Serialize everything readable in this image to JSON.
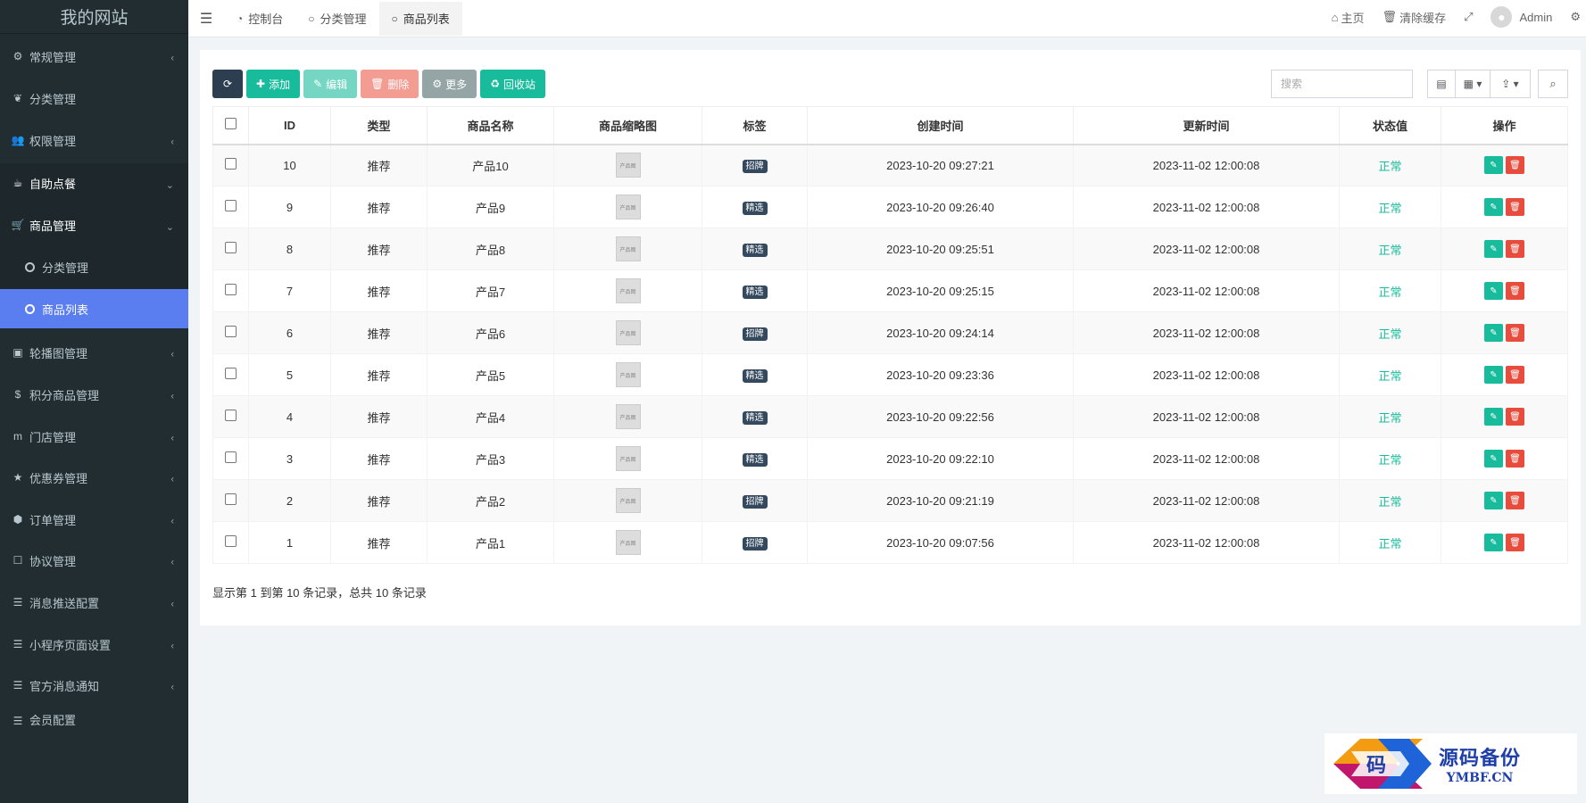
{
  "sidebar": {
    "logo": "我的网站",
    "items": [
      {
        "label": "常规管理",
        "icon": "cogs-icon"
      },
      {
        "label": "分类管理",
        "icon": "leaf-icon"
      },
      {
        "label": "权限管理",
        "icon": "group-icon"
      },
      {
        "label": "自助点餐",
        "icon": "coffee-icon"
      },
      {
        "label": "商品管理",
        "icon": "cart-icon"
      },
      {
        "label": "分类管理",
        "icon": "circle-icon"
      },
      {
        "label": "商品列表",
        "icon": "circle-icon"
      },
      {
        "label": "轮播图管理",
        "icon": "image-icon"
      },
      {
        "label": "积分商品管理",
        "icon": "coin-icon"
      },
      {
        "label": "门店管理",
        "icon": "store-icon"
      },
      {
        "label": "优惠券管理",
        "icon": "star-icon"
      },
      {
        "label": "订单管理",
        "icon": "order-icon"
      },
      {
        "label": "协议管理",
        "icon": "doc-icon"
      },
      {
        "label": "消息推送配置",
        "icon": "list-icon"
      },
      {
        "label": "小程序页面设置",
        "icon": "list-icon"
      },
      {
        "label": "官方消息通知",
        "icon": "list-icon"
      },
      {
        "label": "会员配置",
        "icon": "list-icon"
      }
    ]
  },
  "topnav": {
    "tabs": [
      {
        "label": "控制台",
        "icon": "dashboard-icon"
      },
      {
        "label": "分类管理",
        "icon": "circle-icon"
      },
      {
        "label": "商品列表",
        "icon": "circle-icon"
      }
    ],
    "home": "主页",
    "clear_cache": "清除缓存",
    "user": "Admin"
  },
  "toolbar": {
    "add": "添加",
    "edit": "编辑",
    "delete": "删除",
    "more": "更多",
    "recycle": "回收站",
    "search_placeholder": "搜索"
  },
  "table": {
    "headers": [
      "ID",
      "类型",
      "商品名称",
      "商品缩略图",
      "标签",
      "创建时间",
      "更新时间",
      "状态值",
      "操作"
    ],
    "thumb_text": "产品图",
    "rows": [
      {
        "id": "10",
        "type": "推荐",
        "name": "产品10",
        "tag": "招牌",
        "created": "2023-10-20 09:27:21",
        "updated": "2023-11-02 12:00:08",
        "status": "正常"
      },
      {
        "id": "9",
        "type": "推荐",
        "name": "产品9",
        "tag": "精选",
        "created": "2023-10-20 09:26:40",
        "updated": "2023-11-02 12:00:08",
        "status": "正常"
      },
      {
        "id": "8",
        "type": "推荐",
        "name": "产品8",
        "tag": "精选",
        "created": "2023-10-20 09:25:51",
        "updated": "2023-11-02 12:00:08",
        "status": "正常"
      },
      {
        "id": "7",
        "type": "推荐",
        "name": "产品7",
        "tag": "精选",
        "created": "2023-10-20 09:25:15",
        "updated": "2023-11-02 12:00:08",
        "status": "正常"
      },
      {
        "id": "6",
        "type": "推荐",
        "name": "产品6",
        "tag": "招牌",
        "created": "2023-10-20 09:24:14",
        "updated": "2023-11-02 12:00:08",
        "status": "正常"
      },
      {
        "id": "5",
        "type": "推荐",
        "name": "产品5",
        "tag": "精选",
        "created": "2023-10-20 09:23:36",
        "updated": "2023-11-02 12:00:08",
        "status": "正常"
      },
      {
        "id": "4",
        "type": "推荐",
        "name": "产品4",
        "tag": "精选",
        "created": "2023-10-20 09:22:56",
        "updated": "2023-11-02 12:00:08",
        "status": "正常"
      },
      {
        "id": "3",
        "type": "推荐",
        "name": "产品3",
        "tag": "精选",
        "created": "2023-10-20 09:22:10",
        "updated": "2023-11-02 12:00:08",
        "status": "正常"
      },
      {
        "id": "2",
        "type": "推荐",
        "name": "产品2",
        "tag": "招牌",
        "created": "2023-10-20 09:21:19",
        "updated": "2023-11-02 12:00:08",
        "status": "正常"
      },
      {
        "id": "1",
        "type": "推荐",
        "name": "产品1",
        "tag": "招牌",
        "created": "2023-10-20 09:07:56",
        "updated": "2023-11-02 12:00:08",
        "status": "正常"
      }
    ]
  },
  "pager_info": "显示第 1 到第 10 条记录，总共 10 条记录",
  "watermark": {
    "main": "源码备份",
    "sub": "YMBF.CN",
    "glyph": "码"
  },
  "colors": {
    "sidebar_bg": "#222d32",
    "active": "#5a7ef0",
    "success": "#18bc9c",
    "danger": "#e74c3c",
    "primary_dark": "#2c3e50"
  }
}
